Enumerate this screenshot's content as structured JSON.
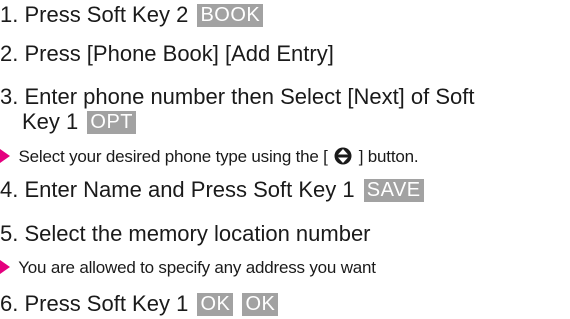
{
  "steps": [
    {
      "text": "1. Press Soft Key 2",
      "keys": [
        "BOOK"
      ]
    },
    {
      "text": "2. Press [Phone Book] [Add Entry]",
      "keys": []
    },
    {
      "text": "3. Enter phone number then Select [Next] of Soft",
      "text_cont": "Key 1",
      "keys": [
        "OPT"
      ]
    },
    {
      "text": "4. Enter Name and Press Soft Key 1",
      "keys": [
        "SAVE"
      ]
    },
    {
      "text": "5. Select the memory location number",
      "keys": []
    },
    {
      "text": "6. Press Soft Key 1",
      "keys": [
        "OK",
        "OK"
      ]
    }
  ],
  "notes": [
    {
      "before": "Select your desired phone type using the [",
      "icon": "up-down-navigation-icon",
      "after": "] button."
    },
    {
      "text": "You are allowed to specify any address you want"
    }
  ],
  "colors": {
    "text": "#1a1a1a",
    "key_background": "#a2a2a2",
    "key_text": "#ffffff",
    "bullet": "#e4007f"
  }
}
